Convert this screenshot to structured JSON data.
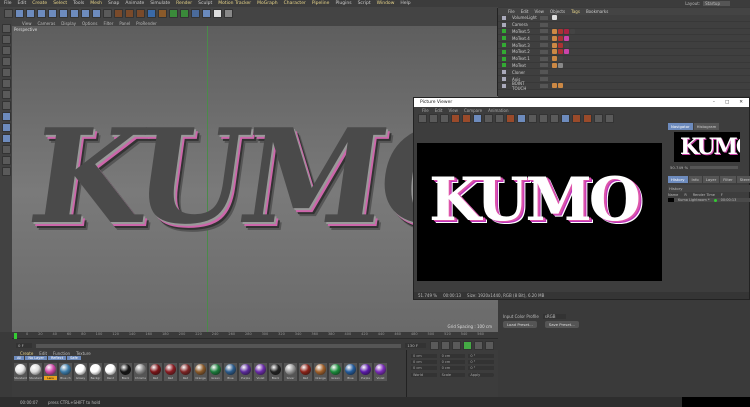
{
  "menu": [
    "File",
    "Edit",
    "Create",
    "Select",
    "Tools",
    "Mesh",
    "Snap",
    "Animate",
    "Simulate",
    "Render",
    "Sculpt",
    "Motion Tracker",
    "MoGraph",
    "Character",
    "Pipeline",
    "Plugins",
    "Script",
    "Window",
    "Help"
  ],
  "layout": {
    "label": "Layout:",
    "value": "Startup"
  },
  "viewport": {
    "menu": [
      "View",
      "Cameras",
      "Display",
      "Options",
      "Filter",
      "Panel",
      "ProRender"
    ],
    "label": "Perspective",
    "grid_spacing": "Grid Spacing : 100 cm",
    "text": "KUMO"
  },
  "object_manager": {
    "menu": [
      "File",
      "Edit",
      "View",
      "Objects",
      "Tags",
      "Bookmarks"
    ],
    "objects": [
      "VolumeLight",
      "Camera",
      "MoText.5",
      "MoText.4",
      "MoText.3",
      "MoText.2",
      "MoText.1",
      "MoText",
      "Cloner",
      "Axis",
      "BOINT TOUCH"
    ]
  },
  "picture_viewer": {
    "title": "Picture Viewer",
    "menu": [
      "File",
      "Edit",
      "View",
      "Compare",
      "Animation"
    ],
    "render_text": "KUMO",
    "tabs_top": [
      "Navigator",
      "Histogram"
    ],
    "zoom": "50.749 %",
    "tabs_bottom": [
      "History",
      "Info",
      "Layer",
      "Filter",
      "Stereo"
    ],
    "history_label": "History",
    "columns": [
      "Name",
      "R",
      "Render Time",
      "F"
    ],
    "history_row": {
      "name": "Kumo Lightroom *",
      "time": "00:00:13"
    },
    "status": {
      "zoom": "51.749 %",
      "time": "00:00:13",
      "size": "Size: 1920x1440, RGB (8 Bit), 6.20 MB"
    }
  },
  "attributes": {
    "input_profile_label": "Input Color Profile",
    "input_profile_value": "sRGB",
    "load_preset": "Load Preset...",
    "save_preset": "Save Preset..."
  },
  "timeline": {
    "ticks": [
      "0",
      "20",
      "40",
      "60",
      "80",
      "100",
      "120",
      "140",
      "160",
      "180",
      "200",
      "220",
      "240",
      "260",
      "280",
      "300",
      "320",
      "340",
      "360",
      "380",
      "400",
      "420",
      "440",
      "460",
      "480",
      "500",
      "520",
      "540",
      "560"
    ],
    "start": "0 F",
    "end": "130 F"
  },
  "material_manager": {
    "menu": [
      "Create",
      "Edit",
      "Function",
      "Texture"
    ],
    "filters": [
      "All",
      "No Layer",
      "Reflect",
      "Safe"
    ],
    "materials": [
      {
        "name": "Standard",
        "color": "#e8e8e8"
      },
      {
        "name": "Standard",
        "color": "#dcdcdc"
      },
      {
        "name": "Lens",
        "color": "#d048a8",
        "selected": true
      },
      {
        "name": "Blue ch",
        "color": "#3a7aa8"
      },
      {
        "name": "Glossy",
        "color": "#ffffff"
      },
      {
        "name": "Backgr",
        "color": "#ffffff"
      },
      {
        "name": "Rend",
        "color": "#ffffff"
      },
      {
        "name": "Black",
        "color": "#151515"
      },
      {
        "name": "Chrome",
        "color": "#8a8a8a"
      },
      {
        "name": "Red",
        "color": "#7a1418"
      },
      {
        "name": "Red",
        "color": "#8a1c22"
      },
      {
        "name": "Red",
        "color": "#7c2424"
      },
      {
        "name": "Orange",
        "color": "#8a5a2a"
      },
      {
        "name": "Green",
        "color": "#1a7a3a"
      },
      {
        "name": "Blue",
        "color": "#2a5a8a"
      },
      {
        "name": "Purple",
        "color": "#5a2a9a"
      },
      {
        "name": "Violet",
        "color": "#6a2aa8"
      },
      {
        "name": "Black",
        "color": "#222222"
      },
      {
        "name": "Silver",
        "color": "#9a9a9a"
      },
      {
        "name": "Red",
        "color": "#8a2218"
      },
      {
        "name": "Orange",
        "color": "#a0602a"
      },
      {
        "name": "Green",
        "color": "#1a8a3a"
      },
      {
        "name": "Blue",
        "color": "#225a9a"
      },
      {
        "name": "Purple",
        "color": "#5a1aa8"
      },
      {
        "name": "Violet",
        "color": "#7a2ab8"
      }
    ]
  },
  "coordinates": {
    "rows": [
      [
        "0 cm",
        "0 cm",
        "0 °"
      ],
      [
        "0 cm",
        "0 cm",
        "0 °"
      ],
      [
        "0 cm",
        "0 cm",
        "0 °"
      ]
    ],
    "mode": "World",
    "scale": "Scale",
    "apply": "Apply"
  },
  "status": {
    "time": "00:00:07",
    "hint": "press CTRL+SHIFT to hold"
  }
}
